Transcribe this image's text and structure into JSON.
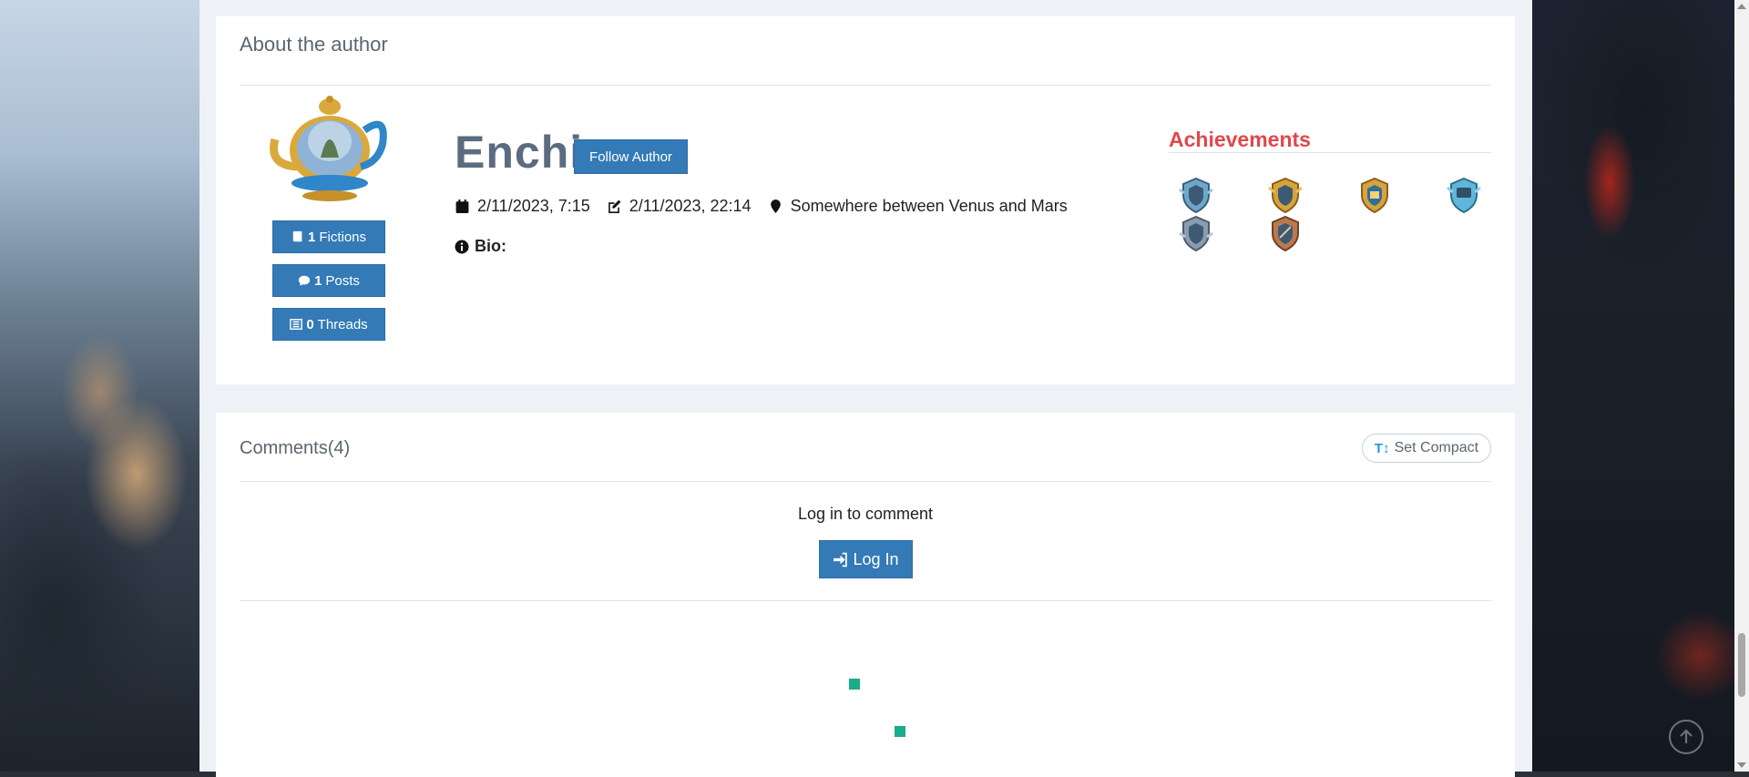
{
  "author_panel": {
    "title": "About the author",
    "name": "Enchi",
    "follow_label": "Follow Author",
    "stats": [
      {
        "count": "1",
        "label": "Fictions",
        "icon": "book-icon"
      },
      {
        "count": "1",
        "label": "Posts",
        "icon": "comment-icon"
      },
      {
        "count": "0",
        "label": "Threads",
        "icon": "list-icon"
      }
    ],
    "joined": "2/11/2023, 7:15",
    "last_active": "2/11/2023, 22:14",
    "location": "Somewhere between Venus and Mars",
    "bio_label": "Bio:",
    "achievements_title": "Achievements",
    "achievements": [
      {
        "icon": "silver-shield-badge-icon",
        "tone": "#6fa7c9"
      },
      {
        "icon": "gold-shield-badge-icon",
        "tone": "#d6a43a"
      },
      {
        "icon": "gold-gift-badge-icon",
        "tone": "#d8a23c"
      },
      {
        "icon": "blue-chat-badge-icon",
        "tone": "#5fb6d9"
      },
      {
        "icon": "silver-wings-badge-icon",
        "tone": "#8b9bb0"
      },
      {
        "icon": "bronze-quill-badge-icon",
        "tone": "#b87a4e"
      }
    ]
  },
  "comments_panel": {
    "title": "Comments(4)",
    "compact_label": "Set Compact",
    "compact_icon": "text-size-icon",
    "login_prompt": "Log in to comment",
    "login_label": "Log In"
  },
  "colors": {
    "primary": "#337ab7",
    "achievements_title": "#e0474c",
    "loader": "#1aab8a"
  }
}
